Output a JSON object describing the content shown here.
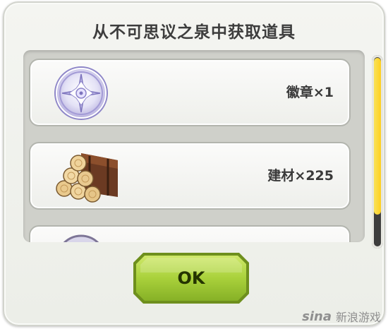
{
  "dialog": {
    "title": "从不可思议之泉中获取道具",
    "items": [
      {
        "label": "徽章×1",
        "icon": "crystal-badge-icon"
      },
      {
        "label": "建材×225",
        "icon": "log-bundle-icon"
      },
      {
        "label": "",
        "icon": "partially-visible-item-icon"
      }
    ],
    "ok_label": "OK"
  },
  "colors": {
    "ok_button": "#a9d13b",
    "scroll_thumb": "#ffd52a"
  },
  "watermark": {
    "logo": "sina",
    "text": "新浪游戏"
  }
}
